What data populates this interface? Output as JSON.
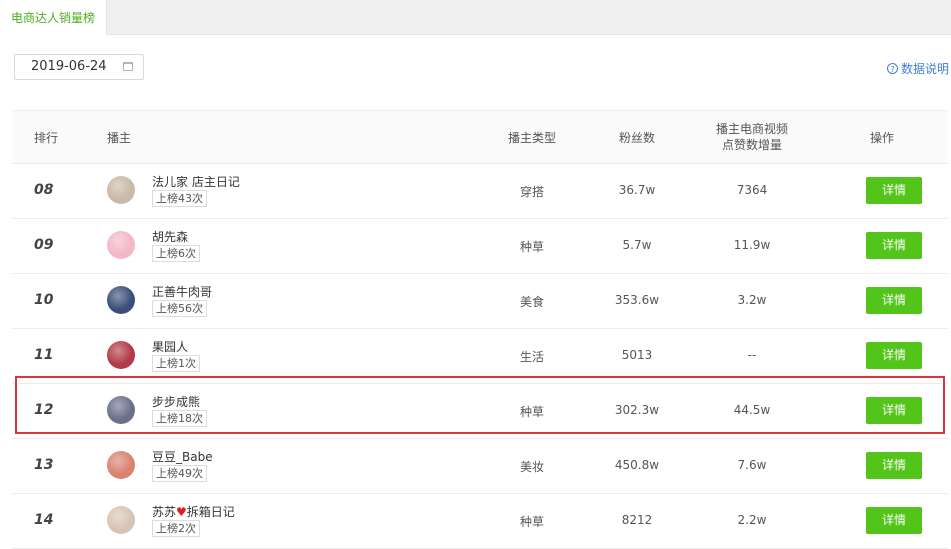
{
  "tab": {
    "label": "电商达人销量榜"
  },
  "date_picker": {
    "value": "2019-06-24"
  },
  "help": {
    "label": "数据说明",
    "icon": "question-circle-icon"
  },
  "table": {
    "headers": {
      "rank": "排行",
      "host": "播主",
      "type": "播主类型",
      "fans": "粉丝数",
      "likes_line1": "播主电商视频",
      "likes_line2": "点赞数增量",
      "op": "操作"
    },
    "rows": [
      {
        "rank": "08",
        "name": "法儿家 店主日记",
        "badge": "上榜43次",
        "type": "穿搭",
        "fans": "36.7w",
        "likes": "7364",
        "action": "详情",
        "avatar_color": "#c9b9a8"
      },
      {
        "rank": "09",
        "name": "胡先森",
        "badge": "上榜6次",
        "type": "种草",
        "fans": "5.7w",
        "likes": "11.9w",
        "action": "详情",
        "avatar_color": "#f2b8c6"
      },
      {
        "rank": "10",
        "name": "正善牛肉哥",
        "badge": "上榜56次",
        "type": "美食",
        "fans": "353.6w",
        "likes": "3.2w",
        "action": "详情",
        "avatar_color": "#3b4f7a"
      },
      {
        "rank": "11",
        "name": "果园人",
        "badge": "上榜1次",
        "type": "生活",
        "fans": "5013",
        "likes": "--",
        "action": "详情",
        "avatar_color": "#b23a48"
      },
      {
        "rank": "12",
        "name": "步步成熊",
        "badge": "上榜18次",
        "type": "种草",
        "fans": "302.3w",
        "likes": "44.5w",
        "action": "详情",
        "avatar_color": "#6b6f8a"
      },
      {
        "rank": "13",
        "name": "豆豆_Babe",
        "badge": "上榜49次",
        "type": "美妆",
        "fans": "450.8w",
        "likes": "7.6w",
        "action": "详情",
        "avatar_color": "#d9826f"
      },
      {
        "rank": "14",
        "name_before": "苏苏",
        "name_after": "拆箱日记",
        "badge": "上榜2次",
        "type": "种草",
        "fans": "8212",
        "likes": "2.2w",
        "action": "详情",
        "avatar_color": "#d8c4b4"
      }
    ]
  },
  "colors": {
    "accent_green": "#52c41a",
    "highlight_red": "#d9363e",
    "link_blue": "#3d7fd9"
  }
}
